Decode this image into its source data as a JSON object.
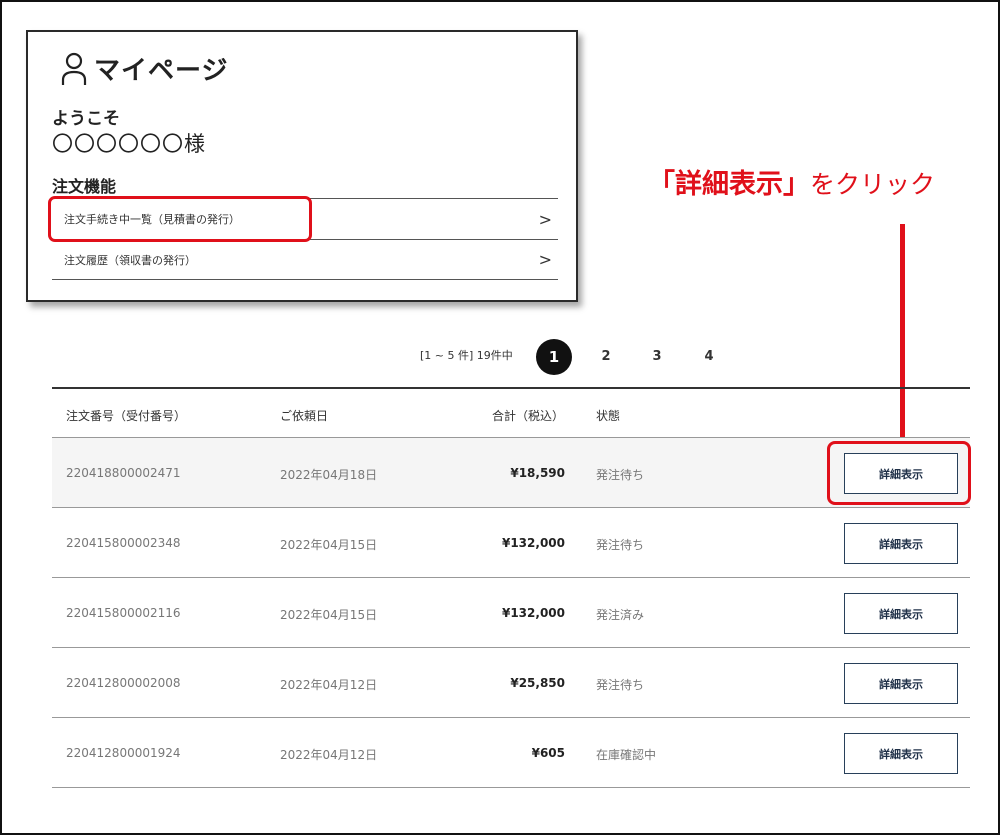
{
  "mypage": {
    "title": "マイページ",
    "welcome": "ようこそ",
    "username": "〇〇〇〇〇〇様",
    "section_title": "注文機能",
    "items": [
      {
        "label": "注文手続き中一覧（見積書の発行）"
      },
      {
        "label": "注文履歴（領収書の発行）"
      }
    ]
  },
  "callout": {
    "strong": "「詳細表示」",
    "rest": "をクリック"
  },
  "pagination": {
    "summary": "[1 ~ 5 件] 19件中",
    "pages": [
      "1",
      "2",
      "3",
      "4"
    ],
    "current": "1"
  },
  "table": {
    "headers": {
      "order_no": "注文番号（受付番号）",
      "date": "ご依頼日",
      "total": "合計（税込）",
      "status": "状態"
    },
    "button_label": "詳細表示",
    "rows": [
      {
        "order_no": "220418800002471",
        "date": "2022年04月18日",
        "total": "¥18,590",
        "status": "発注待ち"
      },
      {
        "order_no": "220415800002348",
        "date": "2022年04月15日",
        "total": "¥132,000",
        "status": "発注待ち"
      },
      {
        "order_no": "220415800002116",
        "date": "2022年04月15日",
        "total": "¥132,000",
        "status": "発注済み"
      },
      {
        "order_no": "220412800002008",
        "date": "2022年04月12日",
        "total": "¥25,850",
        "status": "発注待ち"
      },
      {
        "order_no": "220412800001924",
        "date": "2022年04月12日",
        "total": "¥605",
        "status": "在庫確認中"
      }
    ]
  },
  "colors": {
    "highlight": "#e0101a",
    "button_border": "#28405a",
    "active_page": "#111111"
  }
}
